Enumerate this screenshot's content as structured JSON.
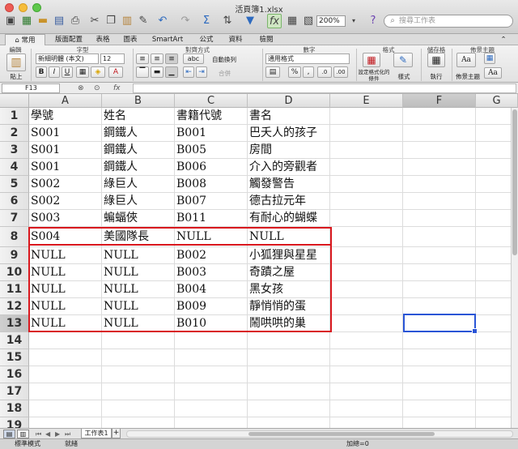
{
  "window": {
    "title": "活頁簿1.xlsx"
  },
  "toolbar": {
    "zoom": "200%",
    "search_placeholder": "搜尋工作表"
  },
  "ribbon": {
    "tabs": [
      "常用",
      "版面配置",
      "表格",
      "圖表",
      "SmartArt",
      "公式",
      "資料",
      "檢閱"
    ],
    "groups": {
      "edit": "編輯",
      "font": "字型",
      "align": "對齊方式",
      "number": "數字",
      "format": "格式",
      "cells": "儲存格",
      "themes": "佈景主題"
    },
    "paste_label": "貼上",
    "font_name": "新細明體 (本文)",
    "font_size": "12",
    "wrap_label": "自動換列",
    "merge_label": "合併",
    "number_format": "通用格式",
    "cond_format_label": "設定格式化的條件",
    "styles_label": "樣式",
    "cells_label": "執行",
    "themes_label": "佈景主題",
    "abc_label": "abc",
    "aa_label": "Aa"
  },
  "formula_bar": {
    "name_box": "F13",
    "fx": "fx",
    "value": ""
  },
  "grid": {
    "columns": [
      "A",
      "B",
      "C",
      "D",
      "E",
      "F",
      "G"
    ],
    "row_numbers": [
      "1",
      "2",
      "3",
      "4",
      "5",
      "6",
      "7",
      "8",
      "9",
      "10",
      "11",
      "12",
      "13",
      "14",
      "15",
      "16",
      "17",
      "18",
      "19"
    ],
    "rows": [
      [
        "學號",
        "姓名",
        "書籍代號",
        "書名"
      ],
      [
        "S001",
        "鋼鐵人",
        "B001",
        "巴夭人的孩子"
      ],
      [
        "S001",
        "鋼鐵人",
        "B005",
        "房間"
      ],
      [
        "S001",
        "鋼鐵人",
        "B006",
        "介入的旁觀者"
      ],
      [
        "S002",
        "綠巨人",
        "B008",
        "觸發警告"
      ],
      [
        "S002",
        "綠巨人",
        "B007",
        "德古拉元年"
      ],
      [
        "S003",
        "蝙蝠俠",
        "B011",
        "有耐心的蝴蝶"
      ],
      [
        "S004",
        "美國隊長",
        "NULL",
        "NULL"
      ],
      [
        "NULL",
        "NULL",
        "B002",
        "小狐狸與星星"
      ],
      [
        "NULL",
        "NULL",
        "B003",
        "奇蹟之屋"
      ],
      [
        "NULL",
        "NULL",
        "B004",
        "黑女孩"
      ],
      [
        "NULL",
        "NULL",
        "B009",
        "靜悄悄的蛋"
      ],
      [
        "NULL",
        "NULL",
        "B010",
        "鬧哄哄的巢"
      ]
    ]
  },
  "sheets": {
    "active_tab": "工作表1",
    "add": "+"
  },
  "status": {
    "view_mode": "標準模式",
    "state": "就緒",
    "sum": "加總=0"
  }
}
